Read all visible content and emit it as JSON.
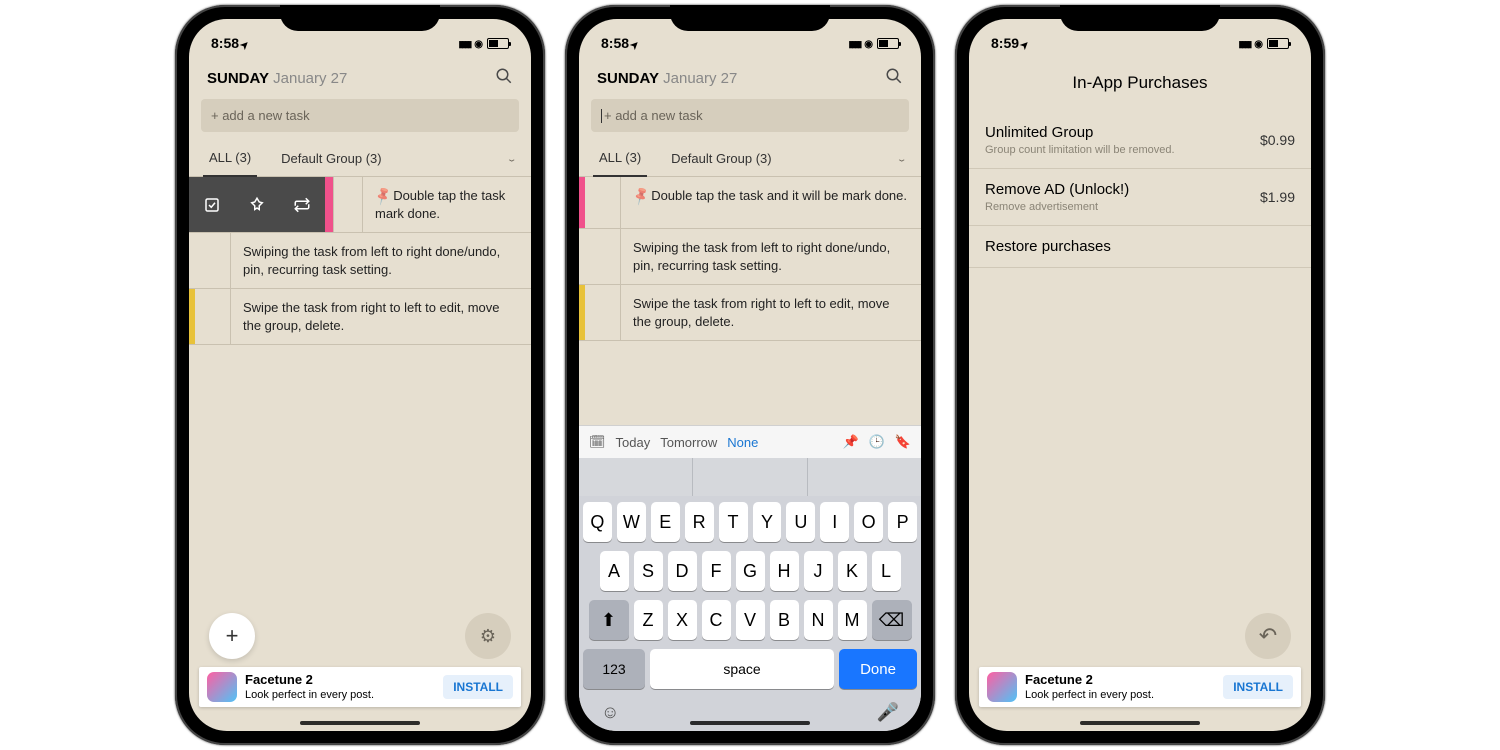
{
  "screens": {
    "s1": {
      "time": "8:58",
      "day": "SUNDAY",
      "date": "January 27",
      "add_placeholder": "+ add a new task",
      "tab_all": "ALL (3)",
      "tab_default": "Default Group (3)",
      "task1": "Double tap the task mark done.",
      "task2": "Swiping the task from left to right done/undo, pin, recurring task setting.",
      "task3": "Swipe the task from right to left to edit, move the group, delete."
    },
    "s2": {
      "time": "8:58",
      "day": "SUNDAY",
      "date": "January 27",
      "add_placeholder": "+ add a new task",
      "tab_all": "ALL (3)",
      "tab_default": "Default Group (3)",
      "task1": "Double tap the task and it will be mark done.",
      "task2": "Swiping the task from left to right done/undo, pin, recurring task setting.",
      "task3": "Swipe the task from right to left to edit, move the group, delete.",
      "today": "Today",
      "tomorrow": "Tomorrow",
      "none": "None",
      "rows": {
        "r1": "QWERTYUIOP",
        "r2": "ASDFGHJKL",
        "r3": "ZXCVBNM"
      },
      "space": "space",
      "done": "Done",
      "num": "123"
    },
    "s3": {
      "time": "8:59",
      "title": "In-App Purchases",
      "p1_title": "Unlimited Group",
      "p1_sub": "Group count limitation will be removed.",
      "p1_price": "$0.99",
      "p2_title": "Remove AD (Unlock!)",
      "p2_sub": "Remove advertisement",
      "p2_price": "$1.99",
      "restore": "Restore purchases"
    },
    "ad": {
      "title": "Facetune 2",
      "sub": "Look perfect in every post.",
      "btn": "INSTALL"
    }
  }
}
